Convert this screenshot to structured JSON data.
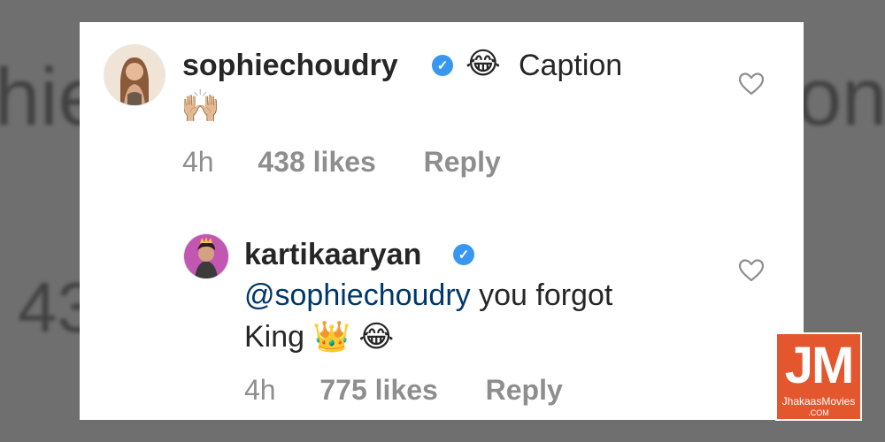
{
  "background": {
    "left_word": "hie",
    "right_word": "on",
    "number": "43"
  },
  "comment": {
    "username": "sophiechoudry",
    "verified": true,
    "text_line1": "Caption",
    "emoji_laugh": "😂",
    "emoji_hands": "🙌🏼",
    "time": "4h",
    "likes": "438 likes",
    "reply": "Reply",
    "avatar_icon": "profile-photo-woman",
    "like_icon": "heart-outline-icon"
  },
  "reply_comment": {
    "username": "kartikaaryan",
    "verified": true,
    "mention": "@sophiechoudry",
    "text_after_mention": " you forgot",
    "text_line2": "King",
    "emoji_crown": "👑",
    "emoji_laugh": "😂",
    "time": "4h",
    "likes": "775 likes",
    "reply": "Reply",
    "avatar_icon": "profile-photo-man",
    "like_icon": "heart-outline-icon"
  },
  "watermark": {
    "big": "JM",
    "site": "JhakaasMovies",
    "tld": ".COM",
    "color": "#e4572e"
  },
  "colors": {
    "verified": "#3897f0",
    "mention": "#00376b",
    "meta": "#8e8e8e"
  }
}
